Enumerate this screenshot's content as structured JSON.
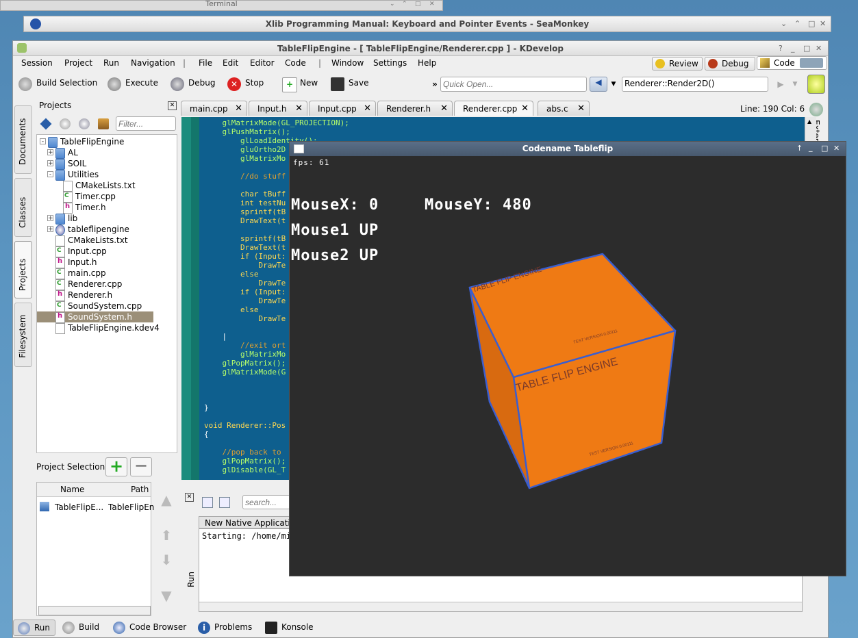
{
  "terminal": {
    "title": "Terminal"
  },
  "seamonkey": {
    "title": "Xlib Programming Manual: Keyboard and Pointer Events - SeaMonkey"
  },
  "kdevelop": {
    "title": "TableFlipEngine - [ TableFlipEngine/Renderer.cpp ] - KDevelop",
    "menu": [
      "Session",
      "Project",
      "Run",
      "Navigation",
      "|",
      "File",
      "Edit",
      "Editor",
      "Code",
      "|",
      "Window",
      "Settings",
      "Help"
    ],
    "areas": {
      "review": "Review",
      "debug": "Debug",
      "code": "Code"
    },
    "toolbar": {
      "build": "Build Selection",
      "execute": "Execute",
      "debug": "Debug",
      "stop": "Stop",
      "new": "New",
      "save": "Save",
      "chevron": "»"
    },
    "quick_open_placeholder": "Quick Open...",
    "context_field": "Renderer::Render2D()",
    "side_tabs": {
      "documents": "Documents",
      "classes": "Classes",
      "projects": "Projects",
      "filesystem": "Filesystem"
    },
    "projects_panel": {
      "title": "Projects",
      "filter_placeholder": "Filter...",
      "tree": [
        {
          "label": "TableFlipEngine",
          "type": "project",
          "indent": 0,
          "exp": "-"
        },
        {
          "label": "AL",
          "type": "folder",
          "indent": 1,
          "exp": "+"
        },
        {
          "label": "SOIL",
          "type": "folder",
          "indent": 1,
          "exp": "+"
        },
        {
          "label": "Utilities",
          "type": "folder",
          "indent": 1,
          "exp": "-"
        },
        {
          "label": "CMakeLists.txt",
          "type": "txt",
          "indent": 2
        },
        {
          "label": "Timer.cpp",
          "type": "cpp",
          "indent": 2
        },
        {
          "label": "Timer.h",
          "type": "h",
          "indent": 2
        },
        {
          "label": "lib",
          "type": "folder",
          "indent": 1,
          "exp": "+"
        },
        {
          "label": "tableflipengine",
          "type": "target",
          "indent": 1,
          "exp": "+"
        },
        {
          "label": "CMakeLists.txt",
          "type": "txt",
          "indent": 1
        },
        {
          "label": "Input.cpp",
          "type": "cpp",
          "indent": 1
        },
        {
          "label": "Input.h",
          "type": "h",
          "indent": 1
        },
        {
          "label": "main.cpp",
          "type": "cpp",
          "indent": 1
        },
        {
          "label": "Renderer.cpp",
          "type": "cpp",
          "indent": 1
        },
        {
          "label": "Renderer.h",
          "type": "h",
          "indent": 1
        },
        {
          "label": "SoundSystem.cpp",
          "type": "cpp",
          "indent": 1
        },
        {
          "label": "SoundSystem.h",
          "type": "h",
          "indent": 1,
          "selected": true
        },
        {
          "label": "TableFlipEngine.kdev4",
          "type": "txt",
          "indent": 1
        }
      ],
      "project_selection": "Project Selection",
      "columns": {
        "name": "Name",
        "path": "Path"
      },
      "selection_row": {
        "name": "TableFlipE...",
        "path": "TableFlipEn"
      }
    },
    "tabs": [
      "main.cpp",
      "Input.h",
      "Input.cpp",
      "Renderer.h",
      "Renderer.cpp",
      "abs.c"
    ],
    "active_tab": "Renderer.cpp",
    "cursor_pos": "Line: 190 Col: 6",
    "side_right_label": "Extern",
    "code_lines": [
      {
        "text": "    glMatrixMode(GL_PROJECTION);",
        "color": "#b8ff6a"
      },
      {
        "text": "    glPushMatrix();",
        "color": "#b8ff6a"
      },
      {
        "text": "        glLoadIdentity();",
        "color": "#b8ff6a"
      },
      {
        "text": "        gluOrtho2D",
        "color": "#b8ff6a"
      },
      {
        "text": "        glMatrixMo",
        "color": "#b8ff6a"
      },
      {
        "text": "",
        "color": "#fff"
      },
      {
        "text": "        //do stuff",
        "color": "#e0a030"
      },
      {
        "text": "",
        "color": "#fff"
      },
      {
        "text": "        char tBuff",
        "color": "#ffd850"
      },
      {
        "text": "        int testNu",
        "color": "#ffd850"
      },
      {
        "text": "        sprintf(tB",
        "color": "#ffd850"
      },
      {
        "text": "        DrawText(t",
        "color": "#ffd850"
      },
      {
        "text": "",
        "color": "#fff"
      },
      {
        "text": "        sprintf(tB",
        "color": "#ffd850"
      },
      {
        "text": "        DrawText(t",
        "color": "#ffd850"
      },
      {
        "text": "        if (Input:",
        "color": "#ffd850"
      },
      {
        "text": "            DrawTe",
        "color": "#ffd850"
      },
      {
        "text": "        else",
        "color": "#ffd850"
      },
      {
        "text": "            DrawTe",
        "color": "#ffd850"
      },
      {
        "text": "        if (Input:",
        "color": "#ffd850"
      },
      {
        "text": "            DrawTe",
        "color": "#ffd850"
      },
      {
        "text": "        else",
        "color": "#ffd850"
      },
      {
        "text": "            DrawTe",
        "color": "#ffd850"
      },
      {
        "text": "",
        "color": "#fff"
      },
      {
        "text": "    |",
        "color": "#fff"
      },
      {
        "text": "        //exit ort",
        "color": "#e0a030"
      },
      {
        "text": "        glMatrixMo",
        "color": "#b8ff6a"
      },
      {
        "text": "    glPopMatrix();",
        "color": "#b8ff6a"
      },
      {
        "text": "    glMatrixMode(G",
        "color": "#b8ff6a"
      },
      {
        "text": "",
        "color": "#fff"
      },
      {
        "text": "",
        "color": "#fff"
      },
      {
        "text": "",
        "color": "#fff"
      },
      {
        "text": "}",
        "color": "#fff"
      },
      {
        "text": "",
        "color": "#fff"
      },
      {
        "text": "void Renderer::Pos",
        "color": "#ffd850"
      },
      {
        "text": "{",
        "color": "#fff"
      },
      {
        "text": "",
        "color": "#fff"
      },
      {
        "text": "    //pop back to",
        "color": "#e0a030"
      },
      {
        "text": "    glPopMatrix();",
        "color": "#b8ff6a"
      },
      {
        "text": "    glDisable(GL_T",
        "color": "#b8ff6a"
      }
    ],
    "run_panel": {
      "search_placeholder": "search...",
      "tab": "New Native Application",
      "output": "Starting: /home/mi",
      "side_label": "Run"
    },
    "bottom_tools": [
      "Run",
      "Build",
      "Code Browser",
      "Problems",
      "Konsole"
    ]
  },
  "game": {
    "title": "Codename Tableflip",
    "fps": "fps: 61",
    "mouse_x": "MouseX: 0",
    "mouse_y": "MouseY: 480",
    "mouse1": "Mouse1 UP",
    "mouse2": "Mouse2 UP",
    "cube_label": "TABLE FLIP ENGINE",
    "cube_sub": "TEST VERSION 0.00111",
    "cube_color": "#ef7a14",
    "edge_color": "#3a5ed0"
  }
}
